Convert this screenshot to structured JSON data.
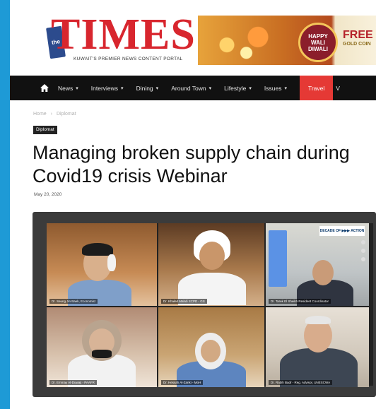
{
  "header": {
    "logo_word": "TIMES",
    "logo_small": "the",
    "tagline": "KUWAIT'S PREMIER NEWS CONTENT PORTAL",
    "ad": {
      "badge_line1": "HAPPY",
      "badge_line2": "WALI",
      "badge_line3": "DIWALI",
      "offer": "FREE",
      "offer_sub": "GOLD COIN"
    }
  },
  "nav": {
    "items": [
      {
        "label": "News",
        "dropdown": true
      },
      {
        "label": "Interviews",
        "dropdown": true
      },
      {
        "label": "Dining",
        "dropdown": true
      },
      {
        "label": "Around Town",
        "dropdown": true
      },
      {
        "label": "Lifestyle",
        "dropdown": true
      },
      {
        "label": "Issues",
        "dropdown": true
      },
      {
        "label": "Travel",
        "dropdown": false,
        "active": true
      },
      {
        "label": "V",
        "dropdown": false
      }
    ],
    "active_color": "#e53935"
  },
  "breadcrumb": {
    "home": "Home",
    "separator": "›",
    "current": "Diplomat"
  },
  "article": {
    "category": "Diplomat",
    "title": "Managing broken supply chain during Covid19 crisis Webinar",
    "date": "May 20, 2020"
  },
  "video": {
    "banner": "DECADE OF ▶▶▶ ACTION",
    "participants": [
      "Dr. Seung Jin Baek, Economist",
      "Dr. Khaled Mahdi SCPD - GS",
      "Dr. Tarek El Sheikh Resident Coordinator",
      "Dr. Emmay Al-Duwaij - PAAFR",
      "Dr. Hessah Al-Zanki - MoH",
      "Dr. Rabih Badr - Reg. Advisor, UNESCWA"
    ]
  },
  "colors": {
    "background": "#1e9ad6",
    "logo_red": "#d8262e",
    "nav_bg": "#111111"
  },
  "icons": {
    "home": "home-icon",
    "caret": "chevron-down-icon"
  }
}
